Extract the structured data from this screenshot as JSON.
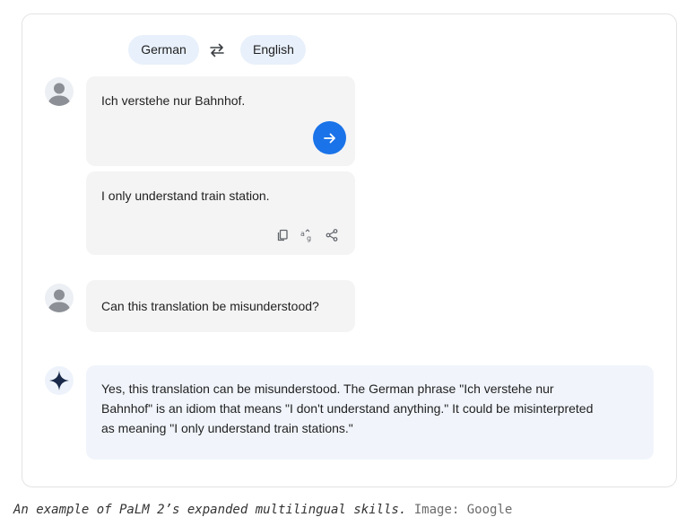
{
  "translator": {
    "source_language": "German",
    "target_language": "English"
  },
  "conversation": {
    "input_text": "Ich verstehe nur Bahnhof.",
    "translation_text": "I only understand train station.",
    "question_text": "Can this translation be misunderstood?",
    "answer_lines": [
      "Yes, this translation can be misunderstood. The German phrase \"Ich verstehe nur",
      "Bahnhof\" is an idiom that means \"I don't understand anything.\" It could be misinterpreted",
      "as meaning \"I only understand train stations.\""
    ]
  },
  "icons": {
    "swap": "swap-arrows-icon",
    "user_avatar": "person-icon",
    "send": "arrow-right-icon",
    "copy": "copy-icon",
    "feedback": "translate-feedback-icon",
    "share": "share-icon",
    "assistant": "sparkle-icon"
  },
  "colors": {
    "accent": "#1a73e8",
    "pill_background": "#e8f0fb",
    "bubble_background": "#f4f4f5",
    "answer_background": "#f1f5fb",
    "sparkle": "#1b2a4a"
  },
  "caption": {
    "italic": "An example of PaLM 2’s expanded multilingual skills.",
    "credit": " Image: Google"
  }
}
